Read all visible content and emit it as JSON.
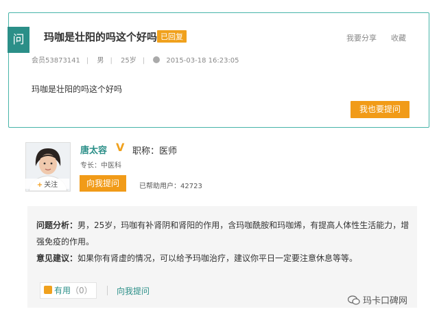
{
  "question": {
    "tag": "问",
    "title": "玛咖是壮阳的吗这个好吗",
    "status_badge": "已回复",
    "share_label": "我要分享",
    "favorite_label": "收藏",
    "meta": {
      "user": "会员53873141",
      "gender": "男",
      "age": "25岁",
      "datetime": "2015-03-18 16:23:05"
    },
    "body": "玛咖是壮阳的吗这个好吗",
    "ask_button": "我也要提问"
  },
  "doctor": {
    "follow_label": "关注",
    "name": "唐太容",
    "verified_mark": "V",
    "title": "职称：医师",
    "specialty": "专长：中医科",
    "ask_button": "向我提问",
    "helped": "已帮助用户：42723"
  },
  "answer": {
    "analysis_label": "问题分析：",
    "analysis_text": "男，25岁，玛咖有补肾阴和肾阳的作用，含玛咖酰胺和玛咖烯，有提高人体性生活能力，增强免疫的作用。",
    "advice_label": "意见建议：",
    "advice_text": "如果你有肾虚的情况，可以给予玛咖治疗，建议你平日一定要注意休息等等。",
    "useful_label": "有用",
    "useful_count": "（0）",
    "ask_link": "向我提问"
  },
  "watermark": "玛卡口碑网",
  "colors": {
    "accent": "#2b8f88",
    "orange": "#f19b18",
    "border": "#46b3a8"
  }
}
